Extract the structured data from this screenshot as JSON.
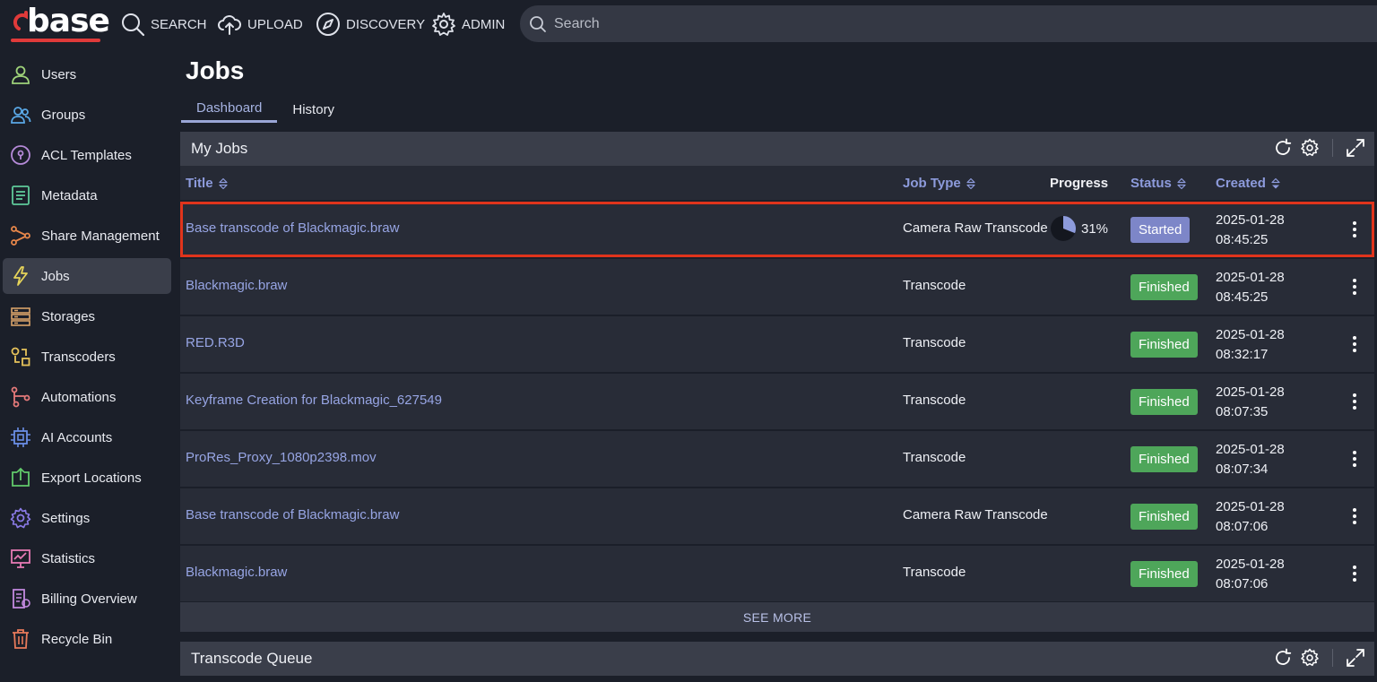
{
  "brand": {
    "name": "base",
    "accent": "#e03a3a"
  },
  "topnav": [
    {
      "label": "SEARCH",
      "icon": "search-icon"
    },
    {
      "label": "UPLOAD",
      "icon": "cloud-upload-icon"
    },
    {
      "label": "DISCOVERY",
      "icon": "compass-icon"
    },
    {
      "label": "ADMIN",
      "icon": "gear-icon"
    }
  ],
  "search": {
    "placeholder": "Search"
  },
  "sidebar": {
    "items": [
      {
        "label": "Users",
        "icon": "user-icon",
        "color": "#9fd37a"
      },
      {
        "label": "Groups",
        "icon": "users-icon",
        "color": "#5aa8e6"
      },
      {
        "label": "ACL Templates",
        "icon": "lock-circle-icon",
        "color": "#b58ad8"
      },
      {
        "label": "Metadata",
        "icon": "document-icon",
        "color": "#5fc99a"
      },
      {
        "label": "Share Management",
        "icon": "share-icon",
        "color": "#e8874a"
      },
      {
        "label": "Jobs",
        "icon": "lightning-icon",
        "color": "#e6d45a",
        "active": true
      },
      {
        "label": "Storages",
        "icon": "server-icon",
        "color": "#d8a36a"
      },
      {
        "label": "Transcoders",
        "icon": "transcode-icon",
        "color": "#e6c25a"
      },
      {
        "label": "Automations",
        "icon": "flow-icon",
        "color": "#e67a7a"
      },
      {
        "label": "AI Accounts",
        "icon": "chip-icon",
        "color": "#6a8ee6"
      },
      {
        "label": "Export Locations",
        "icon": "export-icon",
        "color": "#62c96a"
      },
      {
        "label": "Settings",
        "icon": "settings-icon",
        "color": "#8a7ae6"
      },
      {
        "label": "Statistics",
        "icon": "presentation-chart-icon",
        "color": "#e67ab4"
      },
      {
        "label": "Billing Overview",
        "icon": "billing-icon",
        "color": "#c48ae0"
      },
      {
        "label": "Recycle Bin",
        "icon": "trash-icon",
        "color": "#e87a5a"
      }
    ]
  },
  "page": {
    "title": "Jobs",
    "tabs": [
      {
        "label": "Dashboard",
        "active": true
      },
      {
        "label": "History"
      }
    ]
  },
  "my_jobs": {
    "title": "My Jobs",
    "columns": {
      "title": "Title",
      "job_type": "Job Type",
      "progress": "Progress",
      "status": "Status",
      "created": "Created"
    },
    "rows": [
      {
        "title": "Base transcode of Blackmagic.braw",
        "job_type": "Camera Raw Transcode",
        "progress": 0.31,
        "progress_label": "31%",
        "status": "Started",
        "date": "2025-01-28",
        "time": "08:45:25"
      },
      {
        "title": "Blackmagic.braw",
        "job_type": "Transcode",
        "status": "Finished",
        "date": "2025-01-28",
        "time": "08:45:25"
      },
      {
        "title": "RED.R3D",
        "job_type": "Transcode",
        "status": "Finished",
        "date": "2025-01-28",
        "time": "08:32:17"
      },
      {
        "title": "Keyframe Creation for Blackmagic_627549",
        "job_type": "Transcode",
        "status": "Finished",
        "date": "2025-01-28",
        "time": "08:07:35"
      },
      {
        "title": "ProRes_Proxy_1080p2398.mov",
        "job_type": "Transcode",
        "status": "Finished",
        "date": "2025-01-28",
        "time": "08:07:34"
      },
      {
        "title": "Base transcode of Blackmagic.braw",
        "job_type": "Camera Raw Transcode",
        "status": "Finished",
        "date": "2025-01-28",
        "time": "08:07:06"
      },
      {
        "title": "Blackmagic.braw",
        "job_type": "Transcode",
        "status": "Finished",
        "date": "2025-01-28",
        "time": "08:07:06"
      }
    ],
    "see_more": "SEE MORE"
  },
  "transcode_queue": {
    "title": "Transcode Queue"
  }
}
